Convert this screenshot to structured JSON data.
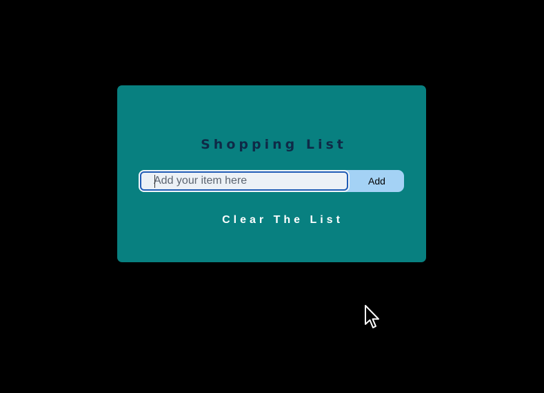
{
  "page": {
    "background_color": "#000000"
  },
  "card": {
    "background_color": "#088080",
    "title": "Shopping List",
    "item_input": {
      "value": "",
      "placeholder": "Add your item here"
    },
    "add_button_label": "Add",
    "add_button_color": "#a4d2f5",
    "clear_button_label": "Clear The List"
  },
  "pointer": {
    "icon": "mouse-pointer-icon"
  }
}
